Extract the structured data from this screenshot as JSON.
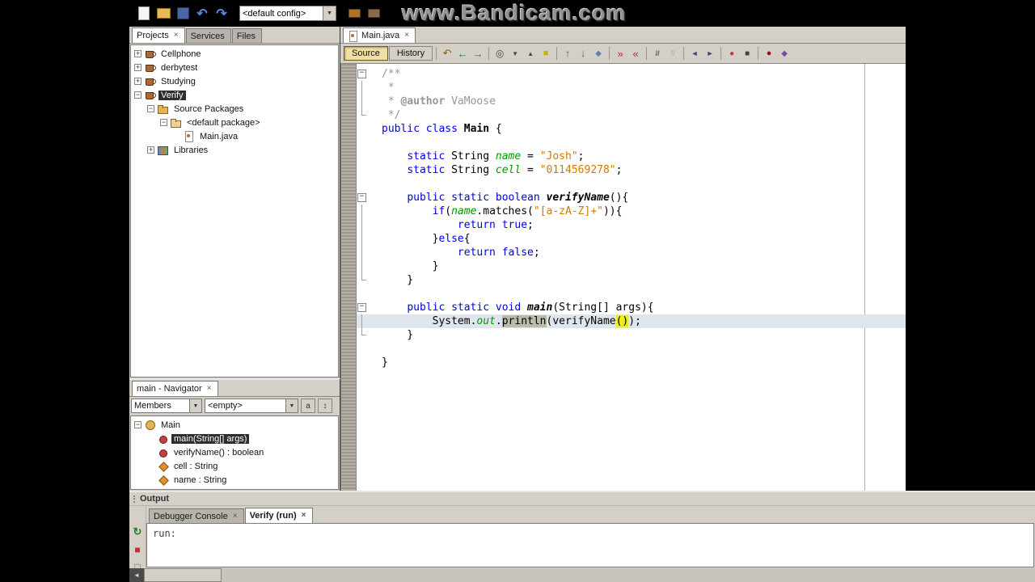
{
  "watermark": "www.Bandicam.com",
  "top_toolbar": {
    "config_combo": "<default config>",
    "left_icons": [
      "new-file",
      "open-project",
      "save-all",
      "undo",
      "redo"
    ],
    "right_icons": [
      "build-project",
      "clean-build"
    ]
  },
  "projects_panel": {
    "tabs": [
      {
        "label": "Projects",
        "close": "×",
        "active": true
      },
      {
        "label": "Services",
        "active": false
      },
      {
        "label": "Files",
        "active": false
      }
    ],
    "tree": [
      {
        "label": "Cellphone",
        "icon": "project",
        "indent": 1,
        "expand": "plus"
      },
      {
        "label": "derbytest",
        "icon": "project",
        "indent": 1,
        "expand": "plus"
      },
      {
        "label": "Studying",
        "icon": "project",
        "indent": 1,
        "expand": "plus"
      },
      {
        "label": "Verify",
        "icon": "project",
        "indent": 1,
        "expand": "minus",
        "selected": true
      },
      {
        "label": "Source Packages",
        "icon": "packages",
        "indent": 2,
        "expand": "minus"
      },
      {
        "label": "<default package>",
        "icon": "package",
        "indent": 3,
        "expand": "minus"
      },
      {
        "label": "Main.java",
        "icon": "java-file",
        "indent": 4
      },
      {
        "label": "Libraries",
        "icon": "libraries",
        "indent": 2,
        "expand": "plus"
      }
    ]
  },
  "navigator_panel": {
    "title": "main - Navigator",
    "close": "×",
    "members_combo": "Members",
    "filter_combo": "<empty>",
    "tree": [
      {
        "label": "Main",
        "icon": "class",
        "indent": 1,
        "expand": "minus"
      },
      {
        "label": "main(String[] args)",
        "icon": "method",
        "indent": 2,
        "selected": true
      },
      {
        "label": "verifyName() : boolean",
        "icon": "method",
        "indent": 2
      },
      {
        "label": "cell : String",
        "icon": "field",
        "indent": 2
      },
      {
        "label": "name : String",
        "icon": "field",
        "indent": 2
      }
    ]
  },
  "editor": {
    "tab": {
      "label": "Main.java",
      "close": "×"
    },
    "source_button": "Source",
    "history_button": "History",
    "toolbar_icons": [
      [
        "last-edit",
        "back",
        "forward"
      ],
      [
        "find-selection",
        "find-next",
        "find-previous",
        "toggle-highlight"
      ],
      [
        "previous-bookmark",
        "next-bookmark",
        "toggle-bookmark"
      ],
      [
        "next-error",
        "previous-error"
      ],
      [
        "comment",
        "uncomment"
      ],
      [
        "shift-left",
        "shift-right"
      ],
      [
        "macro-record",
        "macro-stop"
      ],
      [
        "breakpoint",
        "profile-point"
      ]
    ],
    "code_lines": [
      {
        "fold": "box",
        "segs": [
          [
            "/**",
            "c"
          ]
        ]
      },
      {
        "fold": "line",
        "segs": [
          [
            " *",
            "c"
          ]
        ]
      },
      {
        "fold": "line",
        "segs": [
          [
            " * ",
            "c"
          ],
          [
            "@author",
            "cb"
          ],
          [
            " VaMoose",
            "c"
          ]
        ]
      },
      {
        "fold": "end",
        "segs": [
          [
            " */",
            "c"
          ]
        ]
      },
      {
        "fold": "none",
        "segs": [
          [
            "public class ",
            "k"
          ],
          [
            "Main",
            "cls"
          ],
          [
            " {",
            "p"
          ]
        ]
      },
      {
        "fold": "none",
        "segs": []
      },
      {
        "fold": "none",
        "segs": [
          [
            "    ",
            "p"
          ],
          [
            "static",
            "k"
          ],
          [
            " String ",
            "p"
          ],
          [
            "name",
            "f"
          ],
          [
            " = ",
            "p"
          ],
          [
            "\"Josh\"",
            "s"
          ],
          [
            ";",
            "p"
          ]
        ]
      },
      {
        "fold": "none",
        "segs": [
          [
            "    ",
            "p"
          ],
          [
            "static",
            "k"
          ],
          [
            " String ",
            "p"
          ],
          [
            "cell",
            "f"
          ],
          [
            " = ",
            "p"
          ],
          [
            "\"0114569278\"",
            "s"
          ],
          [
            ";",
            "p"
          ]
        ]
      },
      {
        "fold": "none",
        "segs": []
      },
      {
        "fold": "box",
        "segs": [
          [
            "    ",
            "p"
          ],
          [
            "public static boolean ",
            "k"
          ],
          [
            "verifyName",
            "mi"
          ],
          [
            "(){",
            "p"
          ]
        ]
      },
      {
        "fold": "line",
        "segs": [
          [
            "        ",
            "p"
          ],
          [
            "if",
            "k"
          ],
          [
            "(",
            "p"
          ],
          [
            "name",
            "f"
          ],
          [
            ".matches(",
            "p"
          ],
          [
            "\"[a-zA-Z]+\"",
            "s"
          ],
          [
            ")){",
            "p"
          ]
        ]
      },
      {
        "fold": "line",
        "segs": [
          [
            "            ",
            "p"
          ],
          [
            "return",
            "k"
          ],
          [
            " ",
            "p"
          ],
          [
            "true",
            "k"
          ],
          [
            ";",
            "p"
          ]
        ]
      },
      {
        "fold": "line",
        "segs": [
          [
            "        }",
            "p"
          ],
          [
            "else",
            "k"
          ],
          [
            "{",
            "p"
          ]
        ]
      },
      {
        "fold": "line",
        "segs": [
          [
            "            ",
            "p"
          ],
          [
            "return",
            "k"
          ],
          [
            " ",
            "p"
          ],
          [
            "false",
            "k"
          ],
          [
            ";",
            "p"
          ]
        ]
      },
      {
        "fold": "line",
        "segs": [
          [
            "        }",
            "p"
          ]
        ]
      },
      {
        "fold": "end",
        "segs": [
          [
            "    }",
            "p"
          ]
        ]
      },
      {
        "fold": "none",
        "segs": []
      },
      {
        "fold": "box",
        "segs": [
          [
            "    ",
            "p"
          ],
          [
            "public static void ",
            "k"
          ],
          [
            "main",
            "mi"
          ],
          [
            "(String[] args){",
            "p"
          ]
        ]
      },
      {
        "fold": "line",
        "current": true,
        "segs": [
          [
            "        System.",
            "p"
          ],
          [
            "out",
            "f"
          ],
          [
            ".",
            "p"
          ],
          [
            "println",
            "sel"
          ],
          [
            "(verifyName",
            "p"
          ],
          [
            "()",
            "yhl"
          ],
          [
            ");",
            "p"
          ]
        ]
      },
      {
        "fold": "end",
        "segs": [
          [
            "    }",
            "p"
          ]
        ]
      },
      {
        "fold": "none",
        "segs": []
      },
      {
        "fold": "none",
        "segs": [
          [
            "}",
            "p"
          ]
        ]
      }
    ]
  },
  "output_panel": {
    "title": "Output",
    "tabs": [
      {
        "label": "Debugger Console",
        "close": "×",
        "active": false
      },
      {
        "label": "Verify (run)",
        "close": "×",
        "active": true
      }
    ],
    "side_icons": [
      "rerun",
      "stop",
      "clear"
    ],
    "content": "run:"
  },
  "colors": {
    "keyword": "#0000e6",
    "string": "#ce7b00",
    "field": "#009900",
    "comment": "#969696",
    "selection_dark": "#2e2e2e",
    "bracket_match": "#ecec22",
    "panel_gray": "#d4d0c8"
  }
}
